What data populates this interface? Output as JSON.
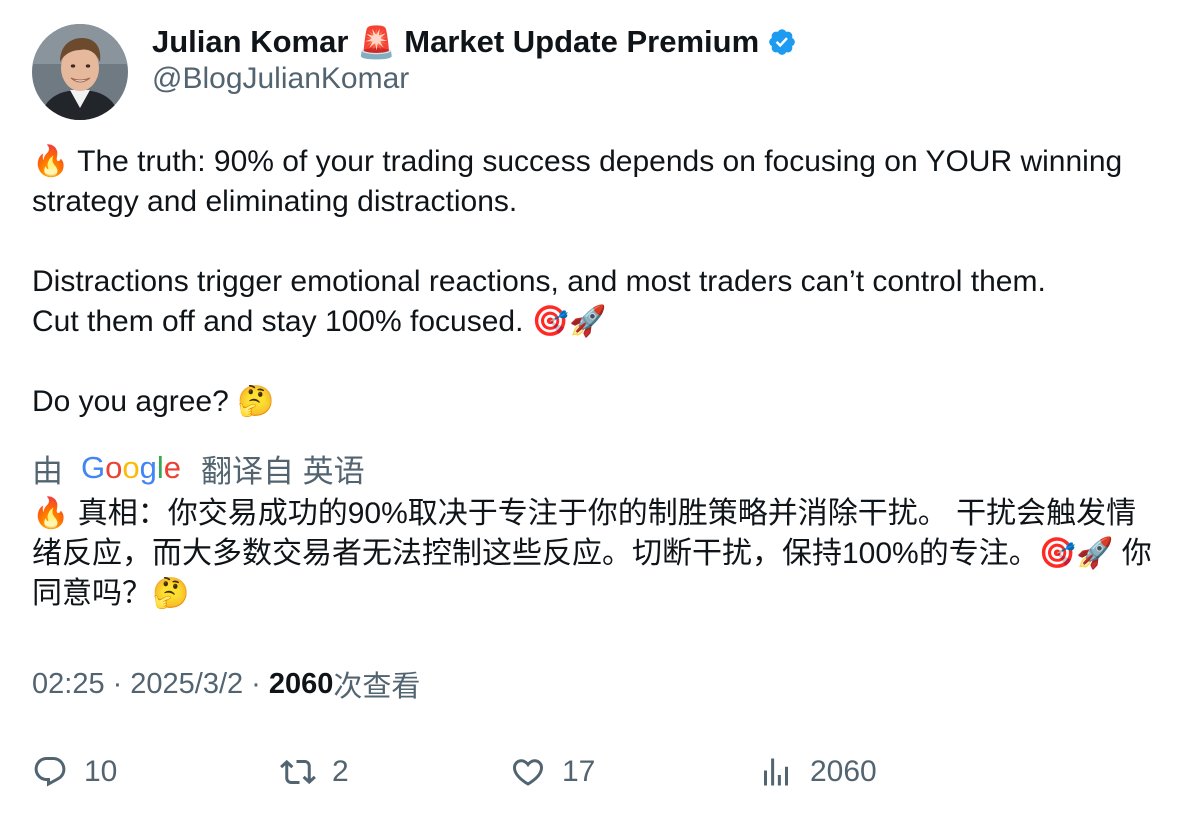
{
  "author": {
    "name": "Julian Komar",
    "badge_emoji": "🚨",
    "name_suffix": "Market Update Premium",
    "handle": "@BlogJulianKomar",
    "verified_color": "#1d9bf0"
  },
  "tweet": {
    "para1_emoji": "🔥",
    "para1": "The truth: 90% of your trading success depends on focusing on YOUR winning strategy and eliminating distractions.",
    "para2_line1": "Distractions trigger emotional reactions, and most traders can’t control them.",
    "para2_line2": "Cut them off and stay 100% focused.",
    "para2_emoji": "🎯🚀",
    "para3": "Do you agree?",
    "para3_emoji": "🤔"
  },
  "translation": {
    "by_label": "由",
    "provider_letters": [
      "G",
      "o",
      "o",
      "g",
      "l",
      "e"
    ],
    "from_label": "翻译自 英语",
    "emoji1": "🔥",
    "text1": "真相：你交易成功的90%取决于专注于你的制胜策略并消除干扰。 干扰会触发情绪反应，而大多数交易者无法控制这些反应。切断干扰，保持100%的专注。",
    "emoji2": "🎯🚀",
    "text2": "你同意吗？",
    "emoji3": "🤔"
  },
  "meta": {
    "time": "02:25",
    "separator": "·",
    "date": "2025/3/2",
    "views_count": "2060",
    "views_label": "次查看"
  },
  "actions": {
    "replies": "10",
    "reposts": "2",
    "likes": "17",
    "views": "2060"
  },
  "colors": {
    "text_primary": "#0f1419",
    "text_secondary": "#536471",
    "google_blue": "#4285f4",
    "google_red": "#ea4335",
    "google_yellow": "#fbbc05",
    "google_green": "#34a853"
  }
}
